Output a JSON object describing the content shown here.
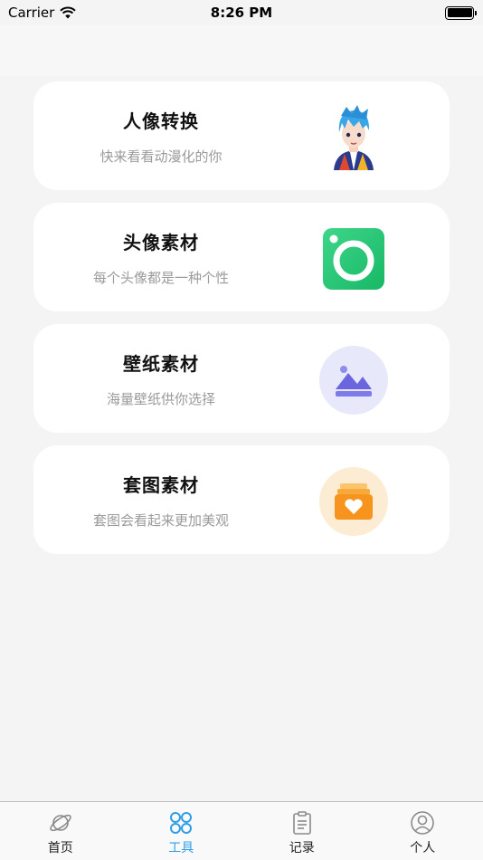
{
  "status_bar": {
    "carrier": "Carrier",
    "time": "8:26 PM"
  },
  "cards": [
    {
      "title": "人像转换",
      "subtitle": "快来看看动漫化的你",
      "icon": "anime-avatar-icon"
    },
    {
      "title": "头像素材",
      "subtitle": "每个头像都是一种个性",
      "icon": "camera-icon"
    },
    {
      "title": "壁纸素材",
      "subtitle": "海量壁纸供你选择",
      "icon": "landscape-image-icon"
    },
    {
      "title": "套图素材",
      "subtitle": "套图会看起来更加美观",
      "icon": "photo-stack-heart-icon"
    }
  ],
  "tab_bar": {
    "active_color": "#2f9ee8",
    "tabs": [
      {
        "label": "首页",
        "icon": "planet-icon",
        "active": false
      },
      {
        "label": "工具",
        "icon": "grid-circles-icon",
        "active": true
      },
      {
        "label": "记录",
        "icon": "clipboard-icon",
        "active": false
      },
      {
        "label": "个人",
        "icon": "user-circle-icon",
        "active": false
      }
    ]
  }
}
